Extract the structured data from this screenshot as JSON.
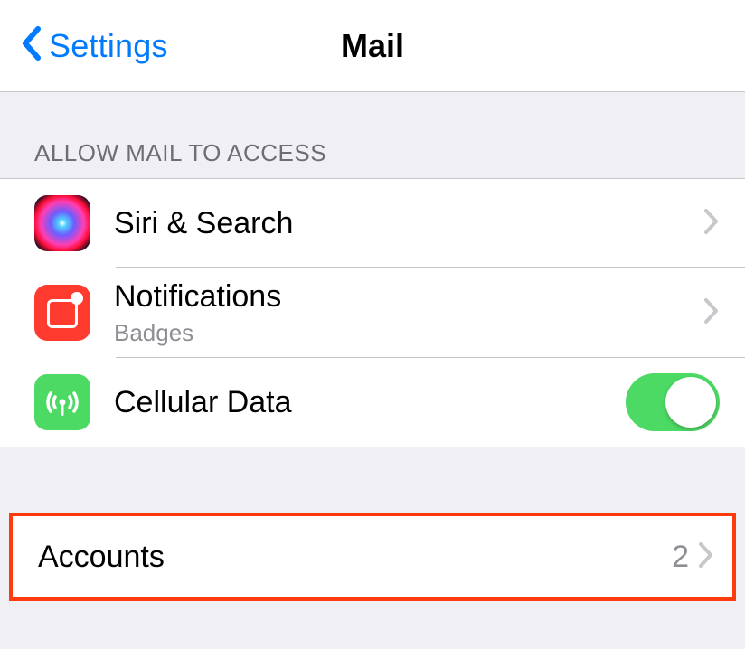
{
  "nav": {
    "back_label": "Settings",
    "title": "Mail"
  },
  "sections": {
    "allow_access_header": "ALLOW MAIL TO ACCESS",
    "rows": {
      "siri": {
        "label": "Siri & Search"
      },
      "notifications": {
        "label": "Notifications",
        "sublabel": "Badges"
      },
      "cellular": {
        "label": "Cellular Data",
        "toggle_on": true
      }
    },
    "accounts": {
      "label": "Accounts",
      "value": "2"
    }
  }
}
